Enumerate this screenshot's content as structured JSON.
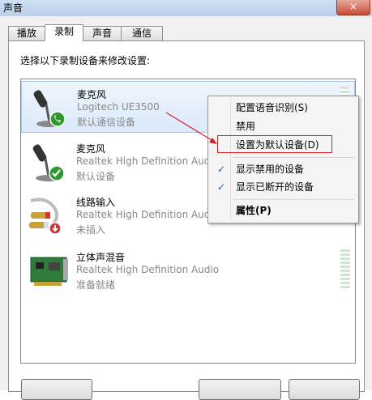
{
  "window": {
    "title": "声音",
    "close_glyph": "×"
  },
  "tabs": [
    {
      "label": "播放"
    },
    {
      "label": "录制",
      "active": true
    },
    {
      "label": "声音"
    },
    {
      "label": "通信"
    }
  ],
  "prompt": "选择以下录制设备来修改设置:",
  "devices": [
    {
      "name": "麦克风",
      "driver": "Logitech UE3500",
      "status": "默认通信设备",
      "icon": "microphone-icon",
      "badge": "phone-check-badge",
      "selected": true
    },
    {
      "name": "麦克风",
      "driver": "Realtek High Definition Audio",
      "status": "默认设备",
      "icon": "microphone-icon",
      "badge": "green-check-badge"
    },
    {
      "name": "线路输入",
      "driver": "Realtek High Definition Audio",
      "status": "未插入",
      "icon": "line-in-cable-icon",
      "badge": "red-down-arrow-badge"
    },
    {
      "name": "立体声混音",
      "driver": "Realtek High Definition Audio",
      "status": "准备就绪",
      "icon": "sound-card-icon"
    }
  ],
  "context_menu": {
    "items": [
      {
        "label": "配置语音识别(S)"
      },
      {
        "label": "禁用"
      },
      {
        "label": "设置为默认设备(D)"
      },
      {
        "label": "显示禁用的设备",
        "checked": true
      },
      {
        "label": "显示已断开的设备",
        "checked": true
      },
      {
        "label": "属性(P)",
        "bold": true
      }
    ],
    "check_glyph": "✓"
  },
  "colors": {
    "accent": "#1c5fb5",
    "annotation": "#d42020"
  }
}
